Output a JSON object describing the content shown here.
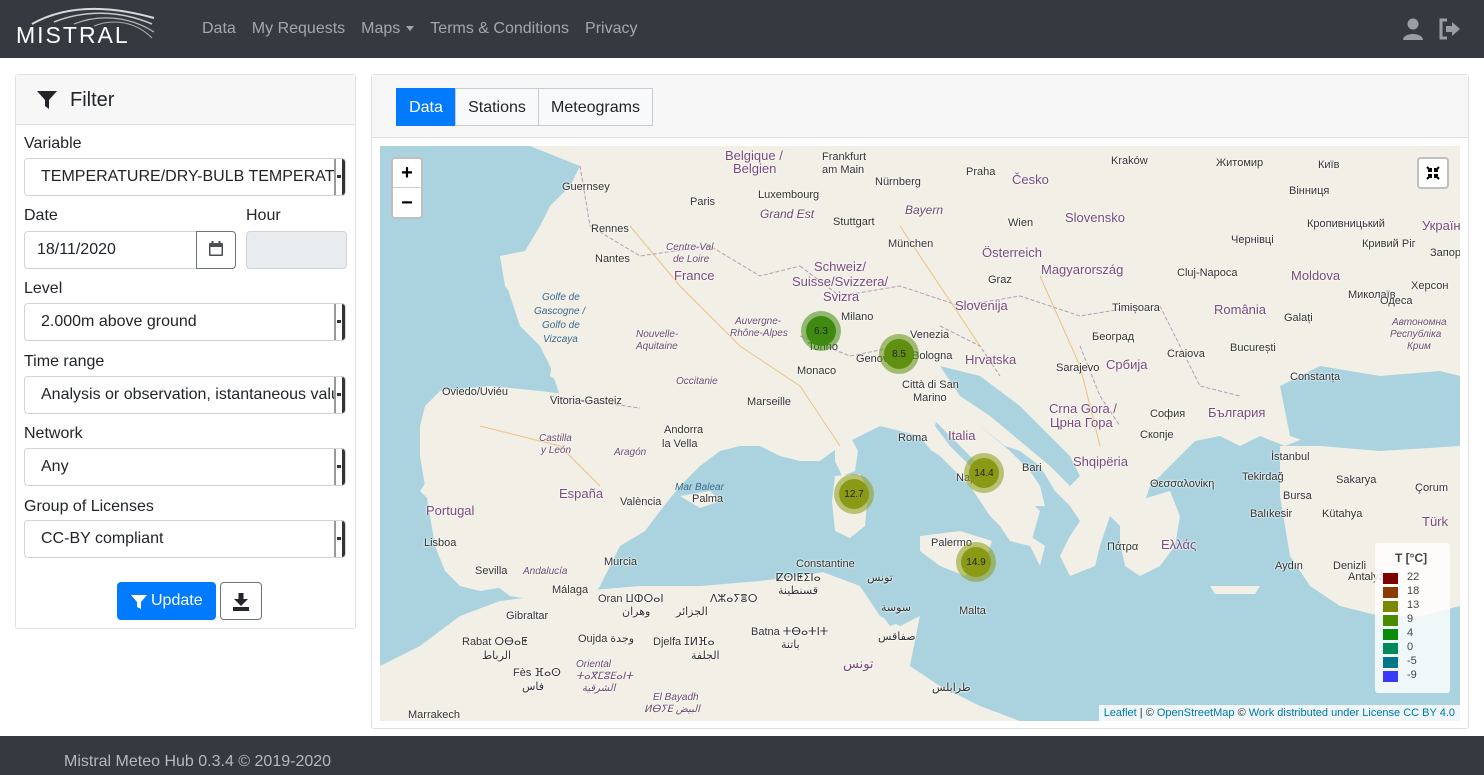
{
  "navbar": {
    "brand": "MISTRAL",
    "links": [
      "Data",
      "My Requests",
      "Maps",
      "Terms & Conditions",
      "Privacy"
    ],
    "icons": [
      "user-icon",
      "sign-out-icon"
    ]
  },
  "filter": {
    "title": "Filter",
    "variable": {
      "label": "Variable",
      "value": "TEMPERATURE/DRY-BULB TEMPERATURE"
    },
    "date": {
      "label": "Date",
      "value": "18/11/2020"
    },
    "hour": {
      "label": "Hour",
      "value": ""
    },
    "level": {
      "label": "Level",
      "value": "2.000m above ground"
    },
    "time_range": {
      "label": "Time range",
      "value": "Analysis or observation, istantaneous value"
    },
    "network": {
      "label": "Network",
      "value": "Any"
    },
    "licenses": {
      "label": "Group of Licenses",
      "value": "CC-BY compliant"
    },
    "update_label": "Update"
  },
  "tabs": [
    {
      "label": "Data",
      "active": true
    },
    {
      "label": "Stations",
      "active": false
    },
    {
      "label": "Meteograms",
      "active": false
    }
  ],
  "map": {
    "zoom_in": "+",
    "zoom_out": "−",
    "clusters": [
      {
        "label": "6.3",
        "color": "#3f8a10"
      },
      {
        "label": "8.5",
        "color": "#5f9010"
      },
      {
        "label": "14.4",
        "color": "#8a9a14"
      },
      {
        "label": "12.7",
        "color": "#8a9a14"
      },
      {
        "label": "14.9",
        "color": "#8a9a14"
      }
    ],
    "legend": {
      "title": "T [°C]",
      "entries": [
        {
          "value": "22",
          "color": "#7f0000"
        },
        {
          "value": "18",
          "color": "#8a3c00"
        },
        {
          "value": "13",
          "color": "#7a8a00"
        },
        {
          "value": "9",
          "color": "#4a8c00"
        },
        {
          "value": "4",
          "color": "#0a8a0a"
        },
        {
          "value": "0",
          "color": "#008a5a"
        },
        {
          "value": "-5",
          "color": "#00788a"
        },
        {
          "value": "-9",
          "color": "#3a3aff"
        }
      ]
    },
    "attribution": {
      "leaflet": "Leaflet",
      "sep1": " | © ",
      "osm": "OpenStreetMap",
      "sep2": " © ",
      "license": "Work distributed under License CC BY 4.0"
    },
    "place_labels": {
      "belgique": "Belgique /",
      "belgien": "Belgien",
      "frankfurt": "Frankfurt",
      "ammain": "am Main",
      "luxembourg": "Luxembourg",
      "grandest": "Grand Est",
      "nurnberg": "Nürnberg",
      "bayern": "Bayern",
      "stuttgart": "Stuttgart",
      "munchen": "München",
      "praha": "Praha",
      "cesko": "Česko",
      "krakow": "Kraków",
      "zhytomyr": "Житомир",
      "kyiv": "Київ",
      "vinnytsia": "Вінниця",
      "ukraina": "Україна",
      "kropyvnytskyi": "Кропивницький",
      "kryvyirih": "Кривий Ріг",
      "zaporizhzhia": "Запорі",
      "chernivtsi": "Чернівці",
      "moldova": "Moldova",
      "mykolaiv": "Миколаїв",
      "kherson": "Херсон",
      "odesa": "Одеса",
      "avtonomna": "Автономна",
      "respublika": "Республіка",
      "krym": "Крим",
      "guernsey": "Guernsey",
      "paris": "Paris",
      "rennes": "Rennes",
      "nantes": "Nantes",
      "centreval": "Centre-Val",
      "deloire": "de Loire",
      "france": "France",
      "schweiz": "Schweiz/",
      "suisse": "Suisse/Svizzera/",
      "svizra": "Svizra",
      "wien": "Wien",
      "osterreich": "Österreich",
      "slovensko": "Slovensko",
      "magyarorszag": "Magyarország",
      "clujnapoca": "Cluj-Napoca",
      "graz": "Graz",
      "slovenija": "Slovenija",
      "timisoara": "Timișoara",
      "romania": "România",
      "galati": "Galați",
      "milano": "Milano",
      "venezia": "Venezia",
      "genova": "Genova",
      "bologna": "Bologna",
      "hrvatska": "Hrvatska",
      "beograd": "Београд",
      "srbija": "Србија",
      "craiova": "Craiova",
      "bucuresti": "București",
      "constanta": "Constanța",
      "golfedegascogne": "Golfe de",
      "gascogne": "Gascogne /",
      "golfode": "Golfo de",
      "vizcaya": "Vizcaya",
      "nouvelle": "Nouvelle-",
      "aquitaine": "Aquitaine",
      "auvergne": "Auvergne-",
      "rhonealpes": "Rhône-Alpes",
      "torino": "Torino",
      "monaco": "Monaco",
      "cittadisanmarino": "Città di San",
      "marino": "Marino",
      "sarajevo": "Sarajevo",
      "crnagora": "Crna Gora /",
      "crnagoracyr": "Црна Гора",
      "sofia": "София",
      "balgariya": "България",
      "skopje": "Скопје",
      "oviedo": "Oviedo/Uviéu",
      "vitoria": "Vitoria-Gasteiz",
      "occitanie": "Occitanie",
      "marseille": "Marseille",
      "andorra": "Andorra",
      "lavella": "la Vella",
      "roma": "Roma",
      "italia": "Italia",
      "shqiperia": "Shqipëria",
      "castilla": "Castilla",
      "yleon": "y León",
      "aragon": "Aragón",
      "napoli": "Napoli",
      "bari": "Bari",
      "istanbul": "İstanbul",
      "tekirdag": "Tekirdağ",
      "sakarya": "Sakarya",
      "thessaloniki": "Θεσσαλονίκη",
      "bursa": "Bursa",
      "espana": "España",
      "marbalear": "Mar Balear",
      "valencia": "València",
      "palma": "Palma",
      "balikesir": "Balıkesir",
      "kutahya": "Kütahya",
      "portugal": "Portugal",
      "turk": "Türk",
      "lisboa": "Lisboa",
      "palermo": "Palermo",
      "patra": "Πάτρα",
      "ellada": "Ελλάς",
      "aydin": "Aydın",
      "denizli": "Denizli",
      "antalya": "Antalya",
      "corum": "Çorum",
      "sevilla": "Sevilla",
      "andalucia": "Andalucía",
      "murcia": "Murcia",
      "constantine": "Constantine",
      "constantineber": "ⵇⵙⵏⵟⵉⵏⴰ",
      "constantinear": "قسنطينة",
      "tunis": "تونس",
      "malaga": "Málaga",
      "oran": "Oran ⵡⵀⵔⴰⵏ",
      "oranar": "وهران",
      "alger": "ⴷⵣⴰⵢⴻⵔ",
      "algerar": "الجزائر",
      "sousse": "سوسة",
      "malta": "Malta",
      "gibraltar": "Gibraltar",
      "rabat": "Rabat ⵔⴱⴰⵟ",
      "rabatar": "الرباط",
      "oujda": "Oujda وجدة",
      "djelfa": "Djelfa ⵊⵍⴼⴰ",
      "djelfaar": "الجلفة",
      "batna": "Batna ⵜⴱⴰⵜⵏⵜ",
      "batnaar": "باتنة",
      "sfax": "صفاقس",
      "tunisie": "تونس",
      "fes": "Fès ⴼⴰⵙ",
      "fesar": "فاس",
      "oriental": "Oriental",
      "orientalber": "ⵜⴰⴳⵎⵓⴹⴰⵏⵜ",
      "orientalar": "الشرقية",
      "elbayadh": "El Bayadh",
      "elbayadhber": "ⵍⴱⵢⴹ البيض",
      "tripoli": "طرابلس",
      "marrakech": "Marrakech"
    }
  },
  "footer": {
    "text": "Mistral Meteo Hub 0.3.4 © 2019-2020"
  }
}
